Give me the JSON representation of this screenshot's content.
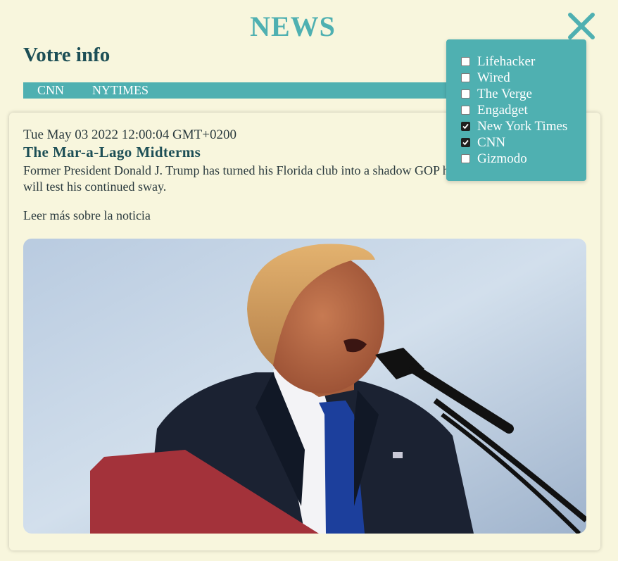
{
  "header": {
    "title": "NEWS",
    "close_icon": "close-icon",
    "section_title": "Votre info"
  },
  "tabs": [
    {
      "label": "CNN"
    },
    {
      "label": "NYTIMES"
    }
  ],
  "article": {
    "date": "Tue May 03 2022 12:00:04 GMT+0200",
    "headline": "The Mar-a-Lago Midterms",
    "description": "Former President Donald J. Trump has turned his Florida club into a shadow GOP headquarters. The elections will test his continued sway.",
    "link_text": "Leer más sobre la noticia"
  },
  "filters": [
    {
      "label": "Lifehacker",
      "checked": false
    },
    {
      "label": "Wired",
      "checked": false
    },
    {
      "label": "The Verge",
      "checked": false
    },
    {
      "label": "Engadget",
      "checked": false
    },
    {
      "label": "New York Times",
      "checked": true
    },
    {
      "label": "CNN",
      "checked": true
    },
    {
      "label": "Gizmodo",
      "checked": false
    }
  ],
  "colors": {
    "background": "#f8f6dd",
    "accent": "#4fb0b1",
    "heading": "#1d4f56",
    "body_text": "#2a3a3e"
  }
}
